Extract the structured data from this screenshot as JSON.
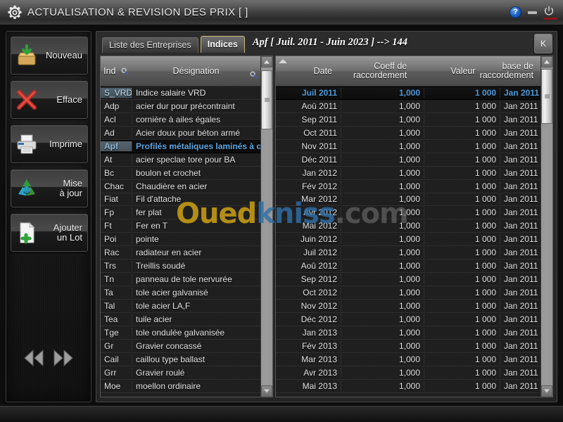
{
  "window": {
    "title": "ACTUALISATION & REVISION DES PRIX  [  ]",
    "gear_icon": "gear-icon",
    "help_label": "?",
    "minimize_label": "",
    "power_label": ""
  },
  "sidebar": {
    "buttons": [
      {
        "label": "Nouveau",
        "icon": "box-download-icon"
      },
      {
        "label": "Efface",
        "icon": "red-x-icon"
      },
      {
        "label": "Imprime",
        "icon": "printer-icon"
      },
      {
        "label": "Mise\nà jour",
        "icon": "recycle-icon"
      },
      {
        "label": "Ajouter\nun Lot",
        "icon": "document-plus-icon"
      }
    ],
    "nav_prev": "prev-double-arrow",
    "nav_next": "next-double-arrow"
  },
  "tabs": [
    {
      "label": "Liste des Entreprises",
      "active": false
    },
    {
      "label": "Indices",
      "active": true
    }
  ],
  "headline": "Apf [ Juil. 2011 - Juin 2023 ] --> 144",
  "k_button": "K",
  "left_grid": {
    "columns": [
      "Ind",
      "Désignation"
    ],
    "selected_index": 4,
    "first_row_highlight": true,
    "rows": [
      {
        "ind": "S_VRD",
        "designation": "Indice salaire VRD"
      },
      {
        "ind": "Adp",
        "designation": "acier dur pour précontraint"
      },
      {
        "ind": "Acl",
        "designation": "cornière à ailes égales"
      },
      {
        "ind": "Ad",
        "designation": "Acier doux pour béton armé"
      },
      {
        "ind": "Apf",
        "designation": "Profilés métaliques laminés à cl"
      },
      {
        "ind": "At",
        "designation": "acier speclae tore pour BA"
      },
      {
        "ind": "Bc",
        "designation": "boulon et crochet"
      },
      {
        "ind": "Chac",
        "designation": "Chaudière en acier"
      },
      {
        "ind": "Fiat",
        "designation": "Fil d'attache"
      },
      {
        "ind": "Fp",
        "designation": "fer plat"
      },
      {
        "ind": "Ft",
        "designation": "Fer en T"
      },
      {
        "ind": "Poi",
        "designation": "pointe"
      },
      {
        "ind": "Rac",
        "designation": "radiateur en acier"
      },
      {
        "ind": "Trs",
        "designation": "Treillis soudé"
      },
      {
        "ind": "Tn",
        "designation": "panneau de tole nervurée"
      },
      {
        "ind": "Ta",
        "designation": "tole acier galvanisé"
      },
      {
        "ind": "Tal",
        "designation": "tole acier LA,F"
      },
      {
        "ind": "Tea",
        "designation": "tuile acier"
      },
      {
        "ind": "Tge",
        "designation": "tole ondulée galvanisée"
      },
      {
        "ind": "Gr",
        "designation": "Gravier concassé"
      },
      {
        "ind": "Cail",
        "designation": "caillou type ballast"
      },
      {
        "ind": "Grr",
        "designation": "Gravier roulé"
      },
      {
        "ind": "Moe",
        "designation": "moellon ordinaire"
      }
    ]
  },
  "right_grid": {
    "columns": [
      "Date",
      "Coeff de\nraccordement",
      "Valeur",
      "base de\nraccordement"
    ],
    "selected_index": 0,
    "rows": [
      {
        "date": "Juil 2011",
        "coeff": "1,000",
        "valeur": "1 000",
        "base": "Jan 2011"
      },
      {
        "date": "Aoû 2011",
        "coeff": "1,000",
        "valeur": "1 000",
        "base": "Jan 2011"
      },
      {
        "date": "Sep 2011",
        "coeff": "1,000",
        "valeur": "1 000",
        "base": "Jan 2011"
      },
      {
        "date": "Oct 2011",
        "coeff": "1,000",
        "valeur": "1 000",
        "base": "Jan 2011"
      },
      {
        "date": "Nov 2011",
        "coeff": "1,000",
        "valeur": "1 000",
        "base": "Jan 2011"
      },
      {
        "date": "Déc 2011",
        "coeff": "1,000",
        "valeur": "1 000",
        "base": "Jan 2011"
      },
      {
        "date": "Jan 2012",
        "coeff": "1,000",
        "valeur": "1 000",
        "base": "Jan 2011"
      },
      {
        "date": "Fév 2012",
        "coeff": "1,000",
        "valeur": "1 000",
        "base": "Jan 2011"
      },
      {
        "date": "Mar 2012",
        "coeff": "1,000",
        "valeur": "1 000",
        "base": "Jan 2011"
      },
      {
        "date": "Avr 2012",
        "coeff": "1,000",
        "valeur": "1 000",
        "base": "Jan 2011"
      },
      {
        "date": "Mai 2012",
        "coeff": "1,000",
        "valeur": "1 000",
        "base": "Jan 2011"
      },
      {
        "date": "Juin 2012",
        "coeff": "1,000",
        "valeur": "1 000",
        "base": "Jan 2011"
      },
      {
        "date": "Juil 2012",
        "coeff": "1,000",
        "valeur": "1 000",
        "base": "Jan 2011"
      },
      {
        "date": "Aoû 2012",
        "coeff": "1,000",
        "valeur": "1 000",
        "base": "Jan 2011"
      },
      {
        "date": "Sep 2012",
        "coeff": "1,000",
        "valeur": "1 000",
        "base": "Jan 2011"
      },
      {
        "date": "Oct 2012",
        "coeff": "1,000",
        "valeur": "1 000",
        "base": "Jan 2011"
      },
      {
        "date": "Nov 2012",
        "coeff": "1,000",
        "valeur": "1 000",
        "base": "Jan 2011"
      },
      {
        "date": "Déc 2012",
        "coeff": "1,000",
        "valeur": "1 000",
        "base": "Jan 2011"
      },
      {
        "date": "Jan 2013",
        "coeff": "1,000",
        "valeur": "1 000",
        "base": "Jan 2011"
      },
      {
        "date": "Fév 2013",
        "coeff": "1,000",
        "valeur": "1 000",
        "base": "Jan 2011"
      },
      {
        "date": "Mar 2013",
        "coeff": "1,000",
        "valeur": "1 000",
        "base": "Jan 2011"
      },
      {
        "date": "Avr 2013",
        "coeff": "1,000",
        "valeur": "1 000",
        "base": "Jan 2011"
      },
      {
        "date": "Mai 2013",
        "coeff": "1,000",
        "valeur": "1 000",
        "base": "Jan 2011"
      }
    ]
  },
  "watermark": {
    "part1": "Oued",
    "part2": "kniss",
    "part3": ".com"
  },
  "colors": {
    "accent_selected_text": "#4f9bdc",
    "active_tab_border": "#cbb77a",
    "watermark_gold": "#d5a612",
    "watermark_blue": "#2f6fa8",
    "power_red": "#8e1414"
  }
}
